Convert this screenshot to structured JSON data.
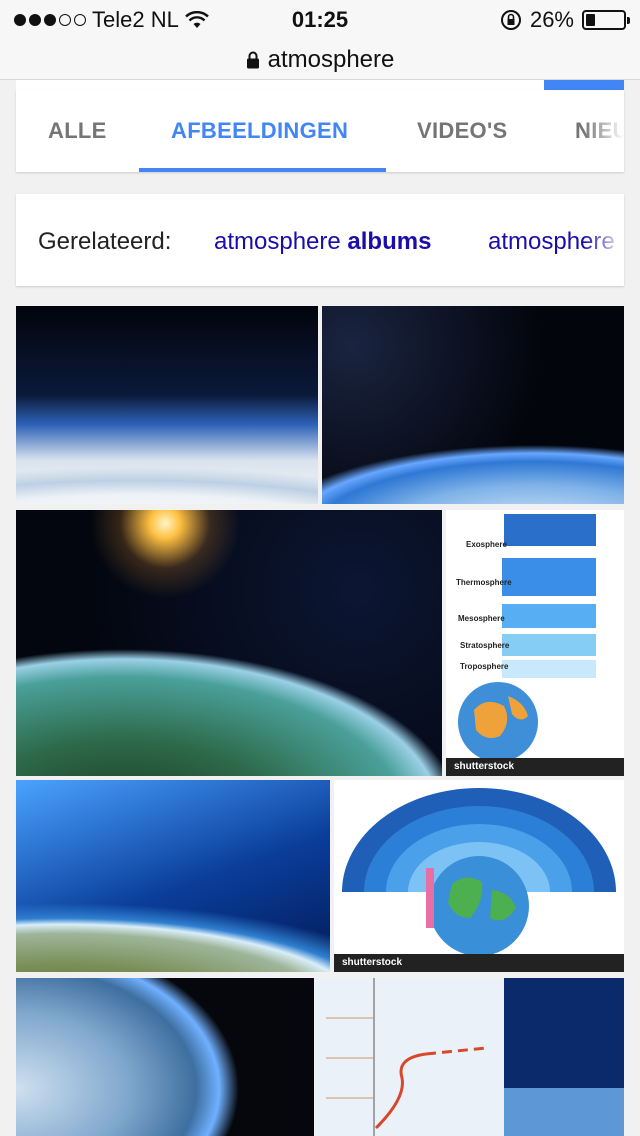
{
  "status_bar": {
    "carrier": "Tele2 NL",
    "time": "01:25",
    "battery_percent": "26%",
    "battery_level": 0.26,
    "signal_bars": 3
  },
  "url_bar": {
    "url": "atmosphere"
  },
  "tabs": [
    {
      "label": "ALLE",
      "active": false
    },
    {
      "label": "AFBEELDINGEN",
      "active": true
    },
    {
      "label": "VIDEO'S",
      "active": false
    },
    {
      "label": "NIEUWS",
      "active": false
    }
  ],
  "related": {
    "label": "Gerelateerd:",
    "chips": [
      {
        "query": "atmosphere ",
        "bold": "albums"
      },
      {
        "query": "atmosphere",
        "bold": ""
      }
    ]
  },
  "images": {
    "infographic_a": {
      "layers": [
        "Exosphere",
        "Thermosphere",
        "Mesosphere",
        "Stratosphere",
        "Troposphere"
      ],
      "watermark": "shutterstock"
    },
    "infographic_b": {
      "watermark": "shutterstock"
    }
  },
  "colors": {
    "accent": "#4285f4",
    "link": "#1a0dab",
    "tab_inactive": "#757575"
  }
}
